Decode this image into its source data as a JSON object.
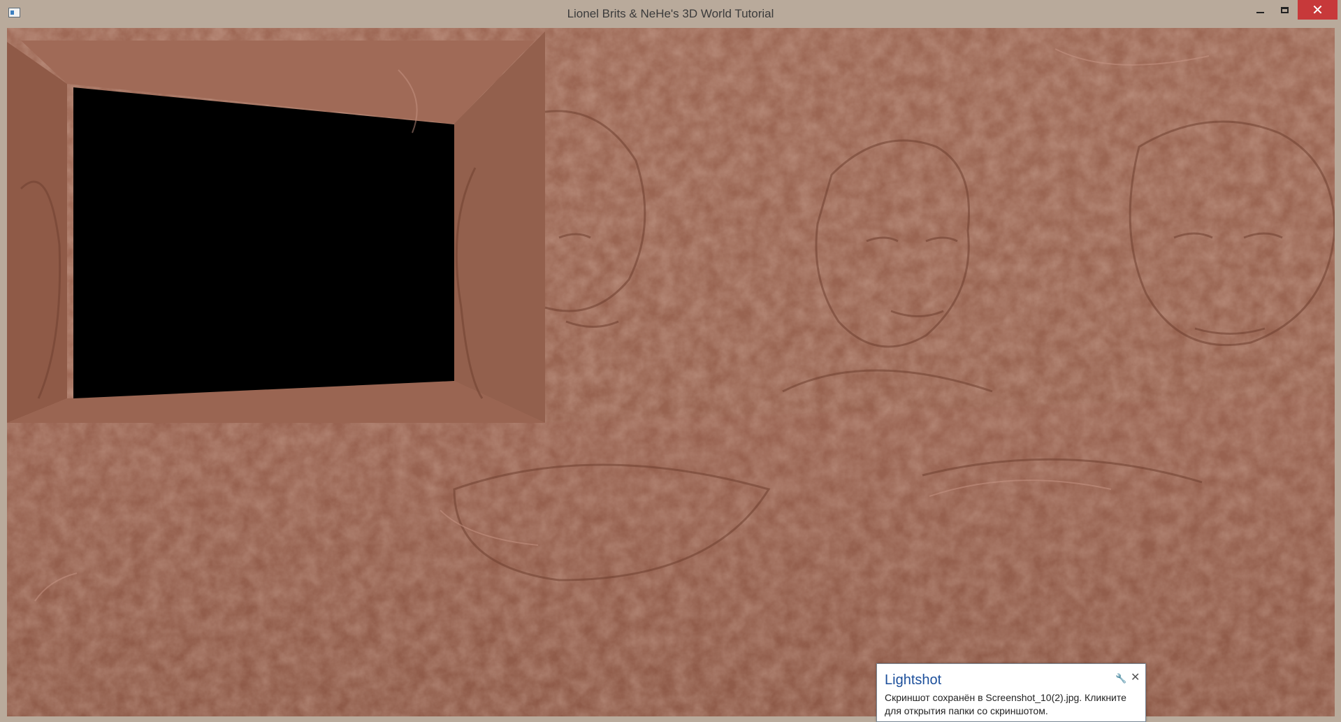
{
  "window": {
    "title": "Lionel Brits & NeHe's 3D World Tutorial",
    "controls": {
      "minimize": "—",
      "maximize": "□",
      "close": "✕"
    }
  },
  "scene": {
    "texture_color": "#9b6450",
    "shadow_color": "#6f3f2f",
    "highlight_color": "#c89685",
    "opening_color": "#000000"
  },
  "notification": {
    "title": "Lightshot",
    "message": "Скриншот сохранён в Screenshot_10(2).jpg. Кликните для открытия папки со скриншотом.",
    "icons": {
      "settings": "wrench-icon",
      "close": "close-icon"
    },
    "close_glyph": "✕",
    "settings_glyph": "🔧"
  }
}
